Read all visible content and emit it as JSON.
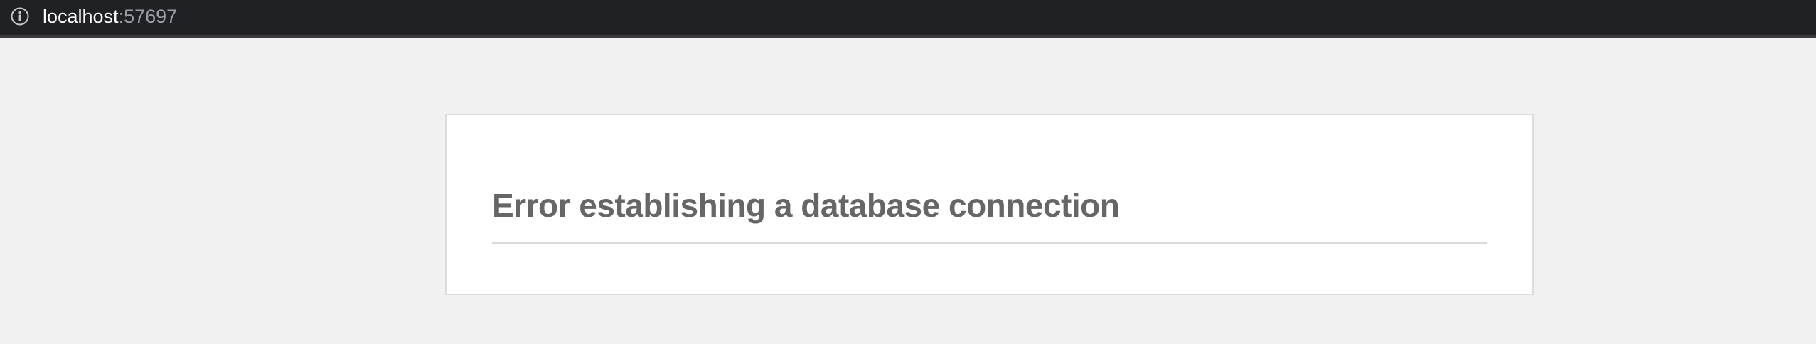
{
  "address_bar": {
    "host": "localhost",
    "port": ":57697",
    "icon": "info-icon"
  },
  "error": {
    "title": "Error establishing a database connection"
  },
  "colors": {
    "background": "#f1f1f1",
    "address_bar": "#202124",
    "title_text": "#666666",
    "box_border": "#dcdcde"
  }
}
